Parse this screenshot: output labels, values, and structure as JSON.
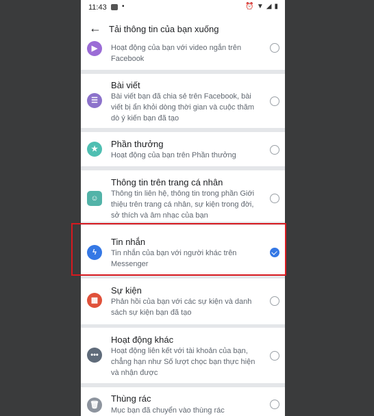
{
  "status": {
    "time": "11:43",
    "dot": "•"
  },
  "header": {
    "back_icon": "arrow-left-icon",
    "title": "Tải thông tin của bạn xuống"
  },
  "items": [
    {
      "title": "",
      "desc": "Hoạt động của bạn với video ngắn trên Facebook",
      "icon": "video-icon",
      "color": "#9b6cd6",
      "checked": false
    },
    {
      "title": "Bài viết",
      "desc": "Bài viết bạn đã chia sẻ trên Facebook, bài viết bị ẩn khỏi dòng thời gian và cuộc thăm dò ý kiến bạn đã tạo",
      "icon": "post-icon",
      "color": "#8c72cb",
      "checked": false
    },
    {
      "title": "Phần thưởng",
      "desc": "Hoạt động của bạn trên Phần thưởng",
      "icon": "star-icon",
      "color": "#4fbfb2",
      "checked": false
    },
    {
      "title": "Thông tin trên trang cá nhân",
      "desc": "Thông tin liên hệ, thông tin trong phần Giới thiệu trên trang cá nhân, sự kiện trong đời, sở thích và âm nhạc của bạn",
      "icon": "profile-icon",
      "color": "#52b3a8",
      "checked": false
    },
    {
      "title": "Tin nhắn",
      "desc": "Tin nhắn của bạn với người khác trên Messenger",
      "icon": "messenger-icon",
      "color": "#3578e5",
      "checked": true
    },
    {
      "title": "Sự kiện",
      "desc": "Phản hồi của bạn với các sự kiện và danh sách sự kiện bạn đã tạo",
      "icon": "calendar-icon",
      "color": "#e0513a",
      "checked": false
    },
    {
      "title": "Hoạt động khác",
      "desc": "Hoạt động liên kết với tài khoản của bạn, chẳng hạn như Số lượt chọc bạn thực hiện và nhận được",
      "icon": "more-icon",
      "color": "#5f6b7a",
      "checked": false
    },
    {
      "title": "Thùng rác",
      "desc": "Mục bạn đã chuyển vào thùng rác",
      "icon": "trash-icon",
      "color": "#8d949e",
      "checked": false
    }
  ]
}
